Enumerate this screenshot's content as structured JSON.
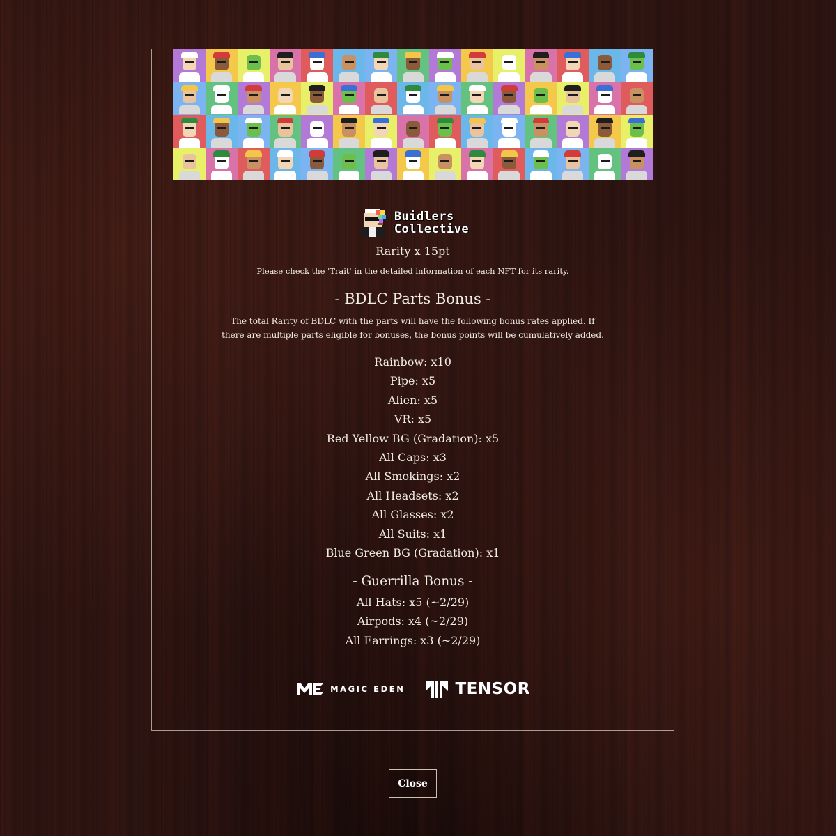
{
  "modal": {
    "banner_alt": "Buidlers Collective NFT grid",
    "logo": {
      "line1": "Buidlers",
      "line2": "Collective",
      "icon": "pixel-avatar-icon"
    },
    "rarity_line": "Rarity x 15pt",
    "rarity_note": "Please check the 'Trait' in the detailed information of each NFT for its rarity.",
    "bdlc_heading": "- BDLC Parts Bonus -",
    "bdlc_description": "The total Rarity of BDLC with the parts will have the following bonus rates applied. If there are multiple parts eligible for bonuses, the bonus points will be cumulatively added.",
    "bdlc_bonuses": [
      "Rainbow: x10",
      "Pipe: x5",
      "Alien: x5",
      "VR: x5",
      "Red Yellow BG (Gradation): x5",
      "All Caps: x3",
      "All Smokings: x2",
      "All Headsets: x2",
      "All Glasses: x2",
      "All Suits: x1",
      "Blue Green BG (Gradation): x1"
    ],
    "guerrilla_heading": "- Guerrilla Bonus -",
    "guerrilla_bonuses": [
      "All Hats: x5 (~2/29)",
      "Airpods: x4 (~2/29)",
      "All Earrings: x3 (~2/29)"
    ],
    "sponsors": {
      "magic_eden": {
        "label": "MAGIC EDEN",
        "icon": "magic-eden-logo-icon"
      },
      "tensor": {
        "label": "TENSOR",
        "icon": "tensor-logo-icon"
      }
    },
    "close_label": "Close"
  },
  "colors": {
    "tile_backgrounds": [
      "#b27ad6",
      "#6bb7e9",
      "#e8f06a",
      "#63c27f",
      "#e05b5b",
      "#f4c84a",
      "#7cb4f2",
      "#d872a8"
    ],
    "text": "#f1ece4",
    "background": "#2e1512"
  }
}
